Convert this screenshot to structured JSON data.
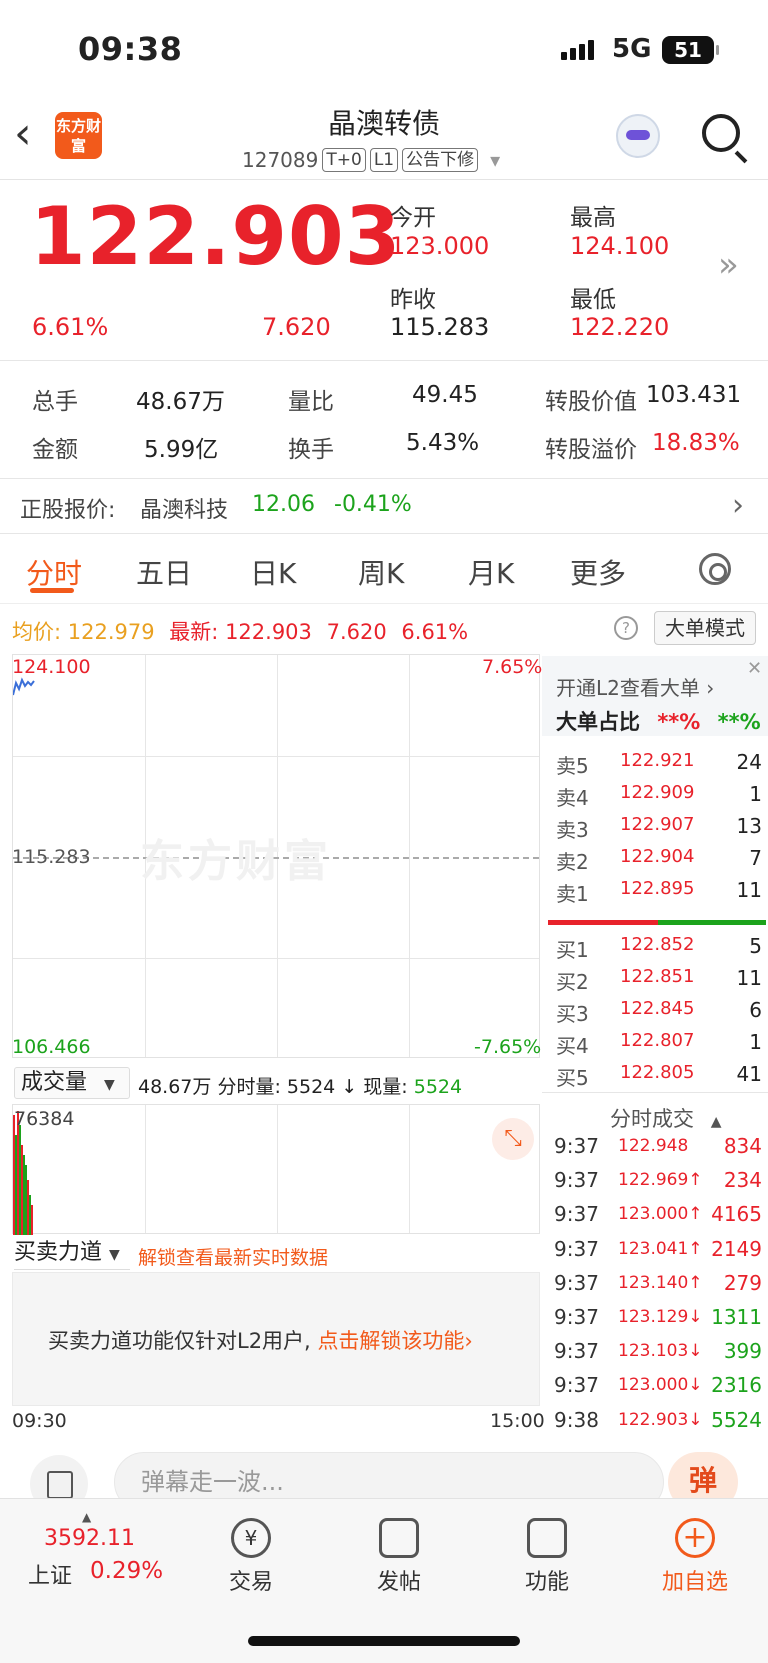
{
  "status_bar": {
    "time": "09:38",
    "network": "5G",
    "battery": "51"
  },
  "header": {
    "back": "‹",
    "logo_text": "东方财富",
    "title": "晶澳转债",
    "code": "127089",
    "tags": [
      "T+0",
      "L1",
      "公告下修"
    ],
    "dropdown": "▾"
  },
  "quote": {
    "price": "122.903",
    "pct": "6.61%",
    "change": "7.620",
    "open_label": "今开",
    "open": "123.000",
    "high_label": "最高",
    "high": "124.100",
    "prev_label": "昨收",
    "prev": "115.283",
    "low_label": "最低",
    "low": "122.220",
    "more": "»"
  },
  "stats": {
    "vol_label": "总手",
    "vol": "48.67万",
    "ratio_label": "量比",
    "ratio": "49.45",
    "convval_label": "转股价值",
    "convval": "103.431",
    "amt_label": "金额",
    "amt": "5.99亿",
    "turn_label": "换手",
    "turn": "5.43%",
    "premium_label": "转股溢价",
    "premium": "18.83%"
  },
  "underlying": {
    "label": "正股报价:",
    "name": "晶澳科技",
    "price": "12.06",
    "change": "-0.41%",
    "arrow": "›"
  },
  "tabs": [
    "分时",
    "五日",
    "日K",
    "周K",
    "月K",
    "更多"
  ],
  "info": {
    "avg_label": "均价:",
    "avg": "122.979",
    "latest_label": "最新:",
    "latest": "122.903",
    "chg": "7.620",
    "pct": "6.61%",
    "help": "?",
    "mode": "大单模式"
  },
  "chart": {
    "top_price": "124.100",
    "top_pct": "7.65%",
    "mid_price": "115.283",
    "bottom_price": "106.466",
    "bottom_pct": "-7.65%",
    "watermark": "东方财富"
  },
  "volume": {
    "select": "成交量",
    "total": "48.67万",
    "tick_label": "分时量:",
    "tick": "5524",
    "now_label": "现量:",
    "now": "5524",
    "max": "76384"
  },
  "force": {
    "select": "买卖力道",
    "unlock": "解锁查看最新实时数据",
    "panel_text": "买卖力道功能仅针对L2用户,",
    "panel_link": "点击解锁该功能›"
  },
  "time_axis": {
    "start": "09:30",
    "end": "15:00"
  },
  "l2": {
    "link": "开通L2查看大单 ›",
    "ratio_label": "大单占比",
    "buy": "**%",
    "sell": "**%",
    "close": "✕"
  },
  "asks": [
    {
      "label": "卖5",
      "price": "122.921",
      "qty": "24"
    },
    {
      "label": "卖4",
      "price": "122.909",
      "qty": "1"
    },
    {
      "label": "卖3",
      "price": "122.907",
      "qty": "13"
    },
    {
      "label": "卖2",
      "price": "122.904",
      "qty": "7"
    },
    {
      "label": "卖1",
      "price": "122.895",
      "qty": "11"
    }
  ],
  "bids": [
    {
      "label": "买1",
      "price": "122.852",
      "qty": "5"
    },
    {
      "label": "买2",
      "price": "122.851",
      "qty": "11"
    },
    {
      "label": "买3",
      "price": "122.845",
      "qty": "6"
    },
    {
      "label": "买4",
      "price": "122.807",
      "qty": "1"
    },
    {
      "label": "买5",
      "price": "122.805",
      "qty": "41"
    }
  ],
  "trades_header": "分时成交",
  "trades": [
    {
      "t": "9:37",
      "p": "122.948",
      "q": "834",
      "c": "red"
    },
    {
      "t": "9:37",
      "p": "122.969↑",
      "q": "234",
      "c": "red"
    },
    {
      "t": "9:37",
      "p": "123.000↑",
      "q": "4165",
      "c": "red"
    },
    {
      "t": "9:37",
      "p": "123.041↑",
      "q": "2149",
      "c": "red"
    },
    {
      "t": "9:37",
      "p": "123.140↑",
      "q": "279",
      "c": "red"
    },
    {
      "t": "9:37",
      "p": "123.129↓",
      "q": "1311",
      "c": "green"
    },
    {
      "t": "9:37",
      "p": "123.103↓",
      "q": "399",
      "c": "green"
    },
    {
      "t": "9:37",
      "p": "123.000↓",
      "q": "2316",
      "c": "green"
    },
    {
      "t": "9:38",
      "p": "122.903↓",
      "q": "5524",
      "c": "green"
    }
  ],
  "danmu": {
    "placeholder": "弹幕走一波...",
    "button": "弹"
  },
  "bottom_nav": {
    "index_value": "3592.11",
    "index_name": "上证",
    "index_pct": "0.29%",
    "items": [
      "交易",
      "发帖",
      "功能",
      "加自选"
    ]
  },
  "colors": {
    "up": "#e8222b",
    "down": "#1ca31c",
    "accent": "#f25a1b"
  }
}
